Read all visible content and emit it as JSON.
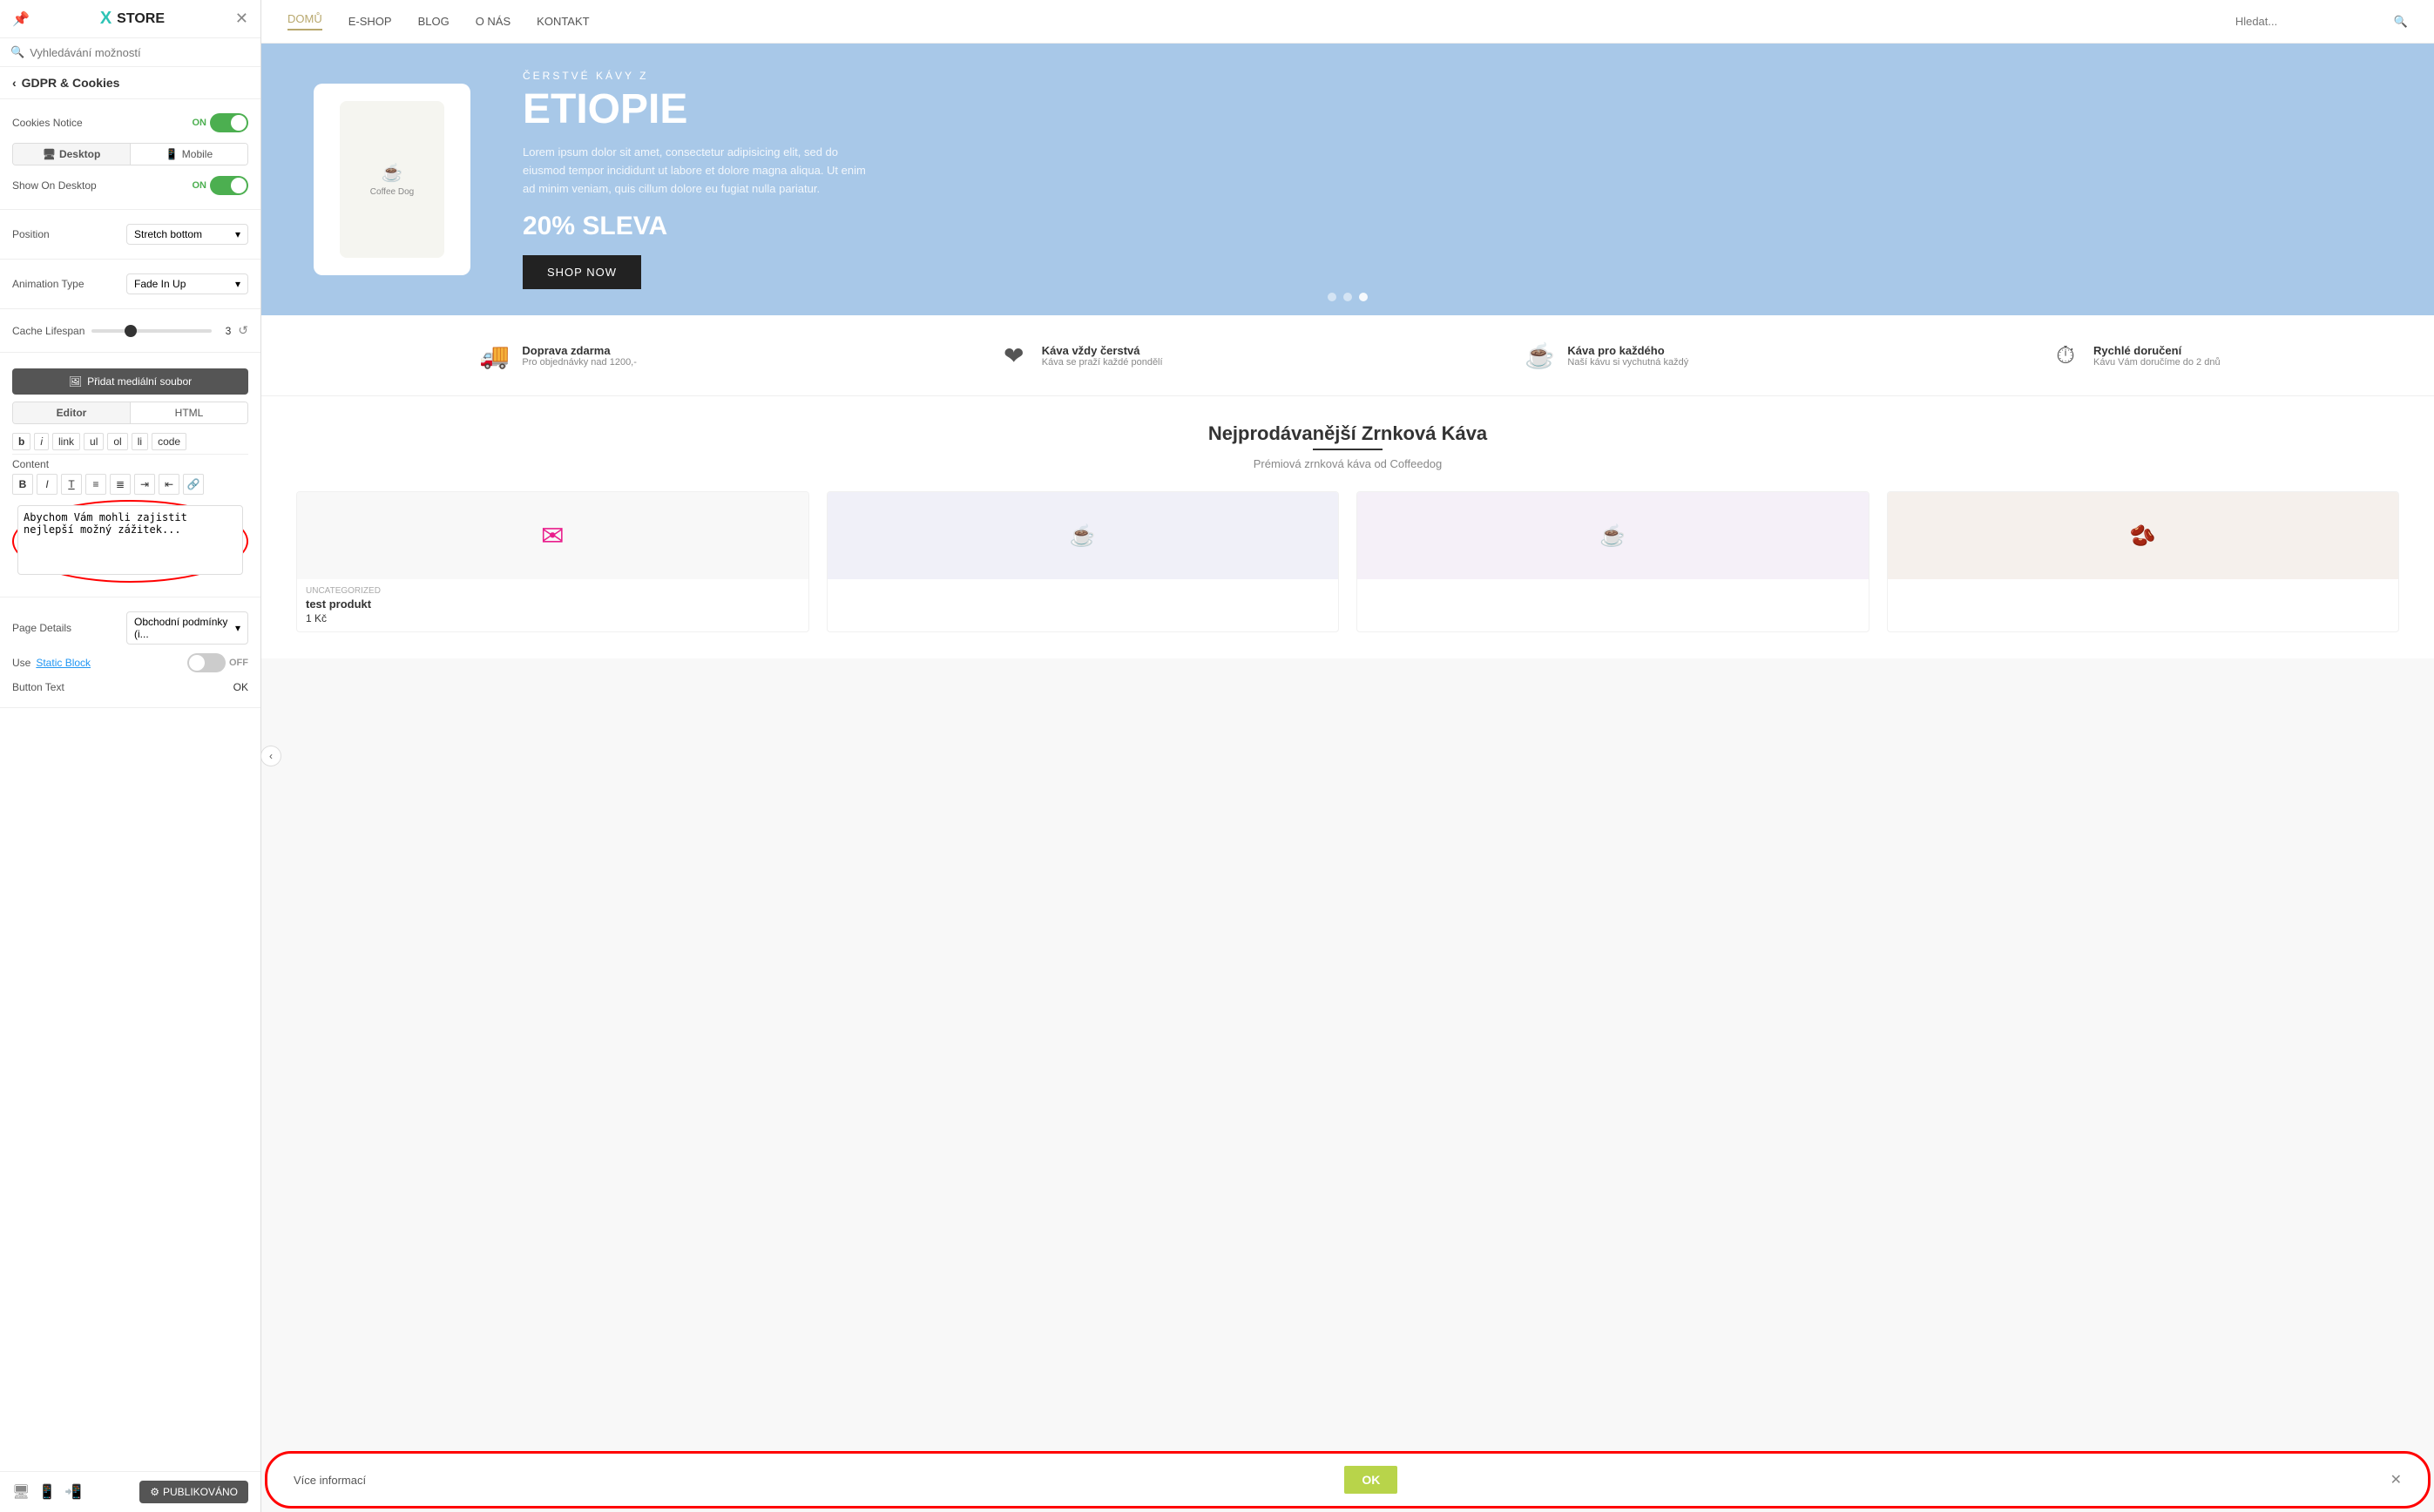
{
  "panel": {
    "logo": "STORE",
    "logo_x": "X",
    "search_placeholder": "Vyhledávání možností",
    "back_label": "GDPR & Cookies",
    "cookies_notice_label": "Cookies Notice",
    "cookies_toggle_on": "ON",
    "desktop_tab": "Desktop",
    "mobile_tab": "Mobile",
    "show_on_desktop_label": "Show On Desktop",
    "show_on_desktop_on": "ON",
    "position_label": "Position",
    "position_value": "Stretch bottom",
    "animation_label": "Animation Type",
    "animation_value": "Fade In Up",
    "cache_label": "Cache Lifespan",
    "cache_value": "3",
    "add_media_btn": "Přidat mediální soubor",
    "editor_tab": "Editor",
    "html_tab": "HTML",
    "fmt_b": "b",
    "fmt_i": "i",
    "fmt_link": "link",
    "fmt_ul": "ul",
    "fmt_ol": "ol",
    "fmt_li": "li",
    "fmt_code": "code",
    "content_label": "Content",
    "content_text": "Abychom Vám mohli zajistit nejlepší možný zážitek...",
    "page_details_label": "Page Details",
    "page_details_value": "Obchodní podmínky (i...",
    "use_static_label": "Use",
    "static_block_link": "Static Block",
    "toggle_off_label": "OFF",
    "button_text_label": "Button Text",
    "button_text_value": "OK",
    "publish_btn": "PUBLIKOVÁNO"
  },
  "nav": {
    "links": [
      {
        "label": "DOMŮ",
        "active": true
      },
      {
        "label": "E-SHOP",
        "active": false
      },
      {
        "label": "BLOG",
        "active": false
      },
      {
        "label": "O NÁS",
        "active": false
      },
      {
        "label": "KONTAKT",
        "active": false
      }
    ],
    "search_placeholder": "Hledat..."
  },
  "hero": {
    "subtitle": "ČERSTVÉ KÁVY Z",
    "title": "ETIOPIE",
    "description": "Lorem ipsum dolor sit amet, consectetur adipisicing elit, sed do eiusmod tempor incididunt ut labore et dolore magna aliqua. Ut enim ad minim veniam, quis cillum dolore eu fugiat nulla pariatur.",
    "discount": "20% SLEVA",
    "shop_now": "SHOP NOW",
    "coffee_logo": "Coffee Dog"
  },
  "features": [
    {
      "icon": "🚚",
      "title": "Doprava zdarma",
      "desc": "Pro objednávky nad 1200,-"
    },
    {
      "icon": "❤",
      "title": "Káva vždy čerstvá",
      "desc": "Káva se praží každé pondělí"
    },
    {
      "icon": "☕",
      "title": "Káva pro každého",
      "desc": "Naší kávu si vychutná každý"
    },
    {
      "icon": "⏰",
      "title": "Rychlé doručení",
      "desc": "Kávu Vám doručíme do 2 dnů"
    }
  ],
  "products": {
    "title": "Nejprodávanější Zrnková Káva",
    "subtitle": "Prémiová zrnková káva od Coffeedog",
    "items": [
      {
        "category": "UNCATEGORIZED",
        "name": "test produkt",
        "price": "1 Kč"
      },
      {
        "category": "",
        "name": "",
        "price": ""
      },
      {
        "category": "",
        "name": "",
        "price": ""
      },
      {
        "category": "",
        "name": "",
        "price": ""
      }
    ]
  },
  "cookie": {
    "text": "Více informací",
    "ok_btn": "OK"
  }
}
